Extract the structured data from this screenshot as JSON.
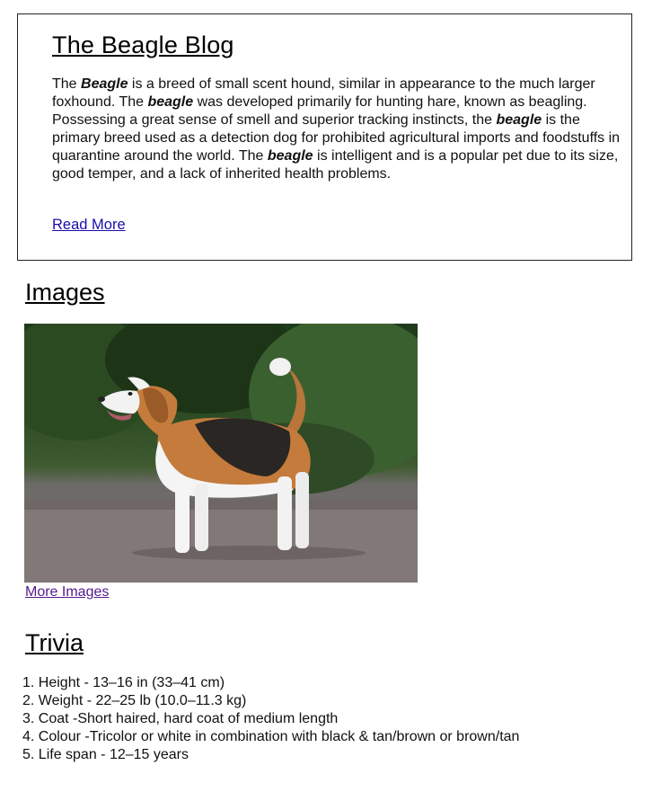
{
  "blog": {
    "title": "The Beagle Blog",
    "paragraph": [
      {
        "text": "The ",
        "em": false
      },
      {
        "text": "Beagle",
        "em": true
      },
      {
        "text": " is a breed of small scent hound, similar in appearance to the much larger foxhound. The ",
        "em": false
      },
      {
        "text": "beagle",
        "em": true
      },
      {
        "text": " was developed primarily for hunting hare, known as beagling. Possessing a great sense of smell and superior tracking instincts, the ",
        "em": false
      },
      {
        "text": "beagle",
        "em": true
      },
      {
        "text": " is the primary breed used as a detection dog for prohibited agricultural imports and foodstuffs in quarantine around the world. The ",
        "em": false
      },
      {
        "text": "beagle",
        "em": true
      },
      {
        "text": " is intelligent and is a popular pet due to its size, good temper, and a lack of inherited health problems.",
        "em": false
      }
    ],
    "read_more": "Read More"
  },
  "images": {
    "title": "Images",
    "photo_icon": "beagle-photo",
    "more_images": "More Images"
  },
  "trivia": {
    "title": "Trivia",
    "items": [
      "1. Height - 13–16 in (33–41 cm)",
      "2. Weight - 22–25 lb (10.0–11.3 kg)",
      "3. Coat -Short haired, hard coat of medium length",
      "4. Colour -Tricolor or white in combination with black & tan/brown or brown/tan",
      "5. Life span - 12–15 years"
    ]
  }
}
